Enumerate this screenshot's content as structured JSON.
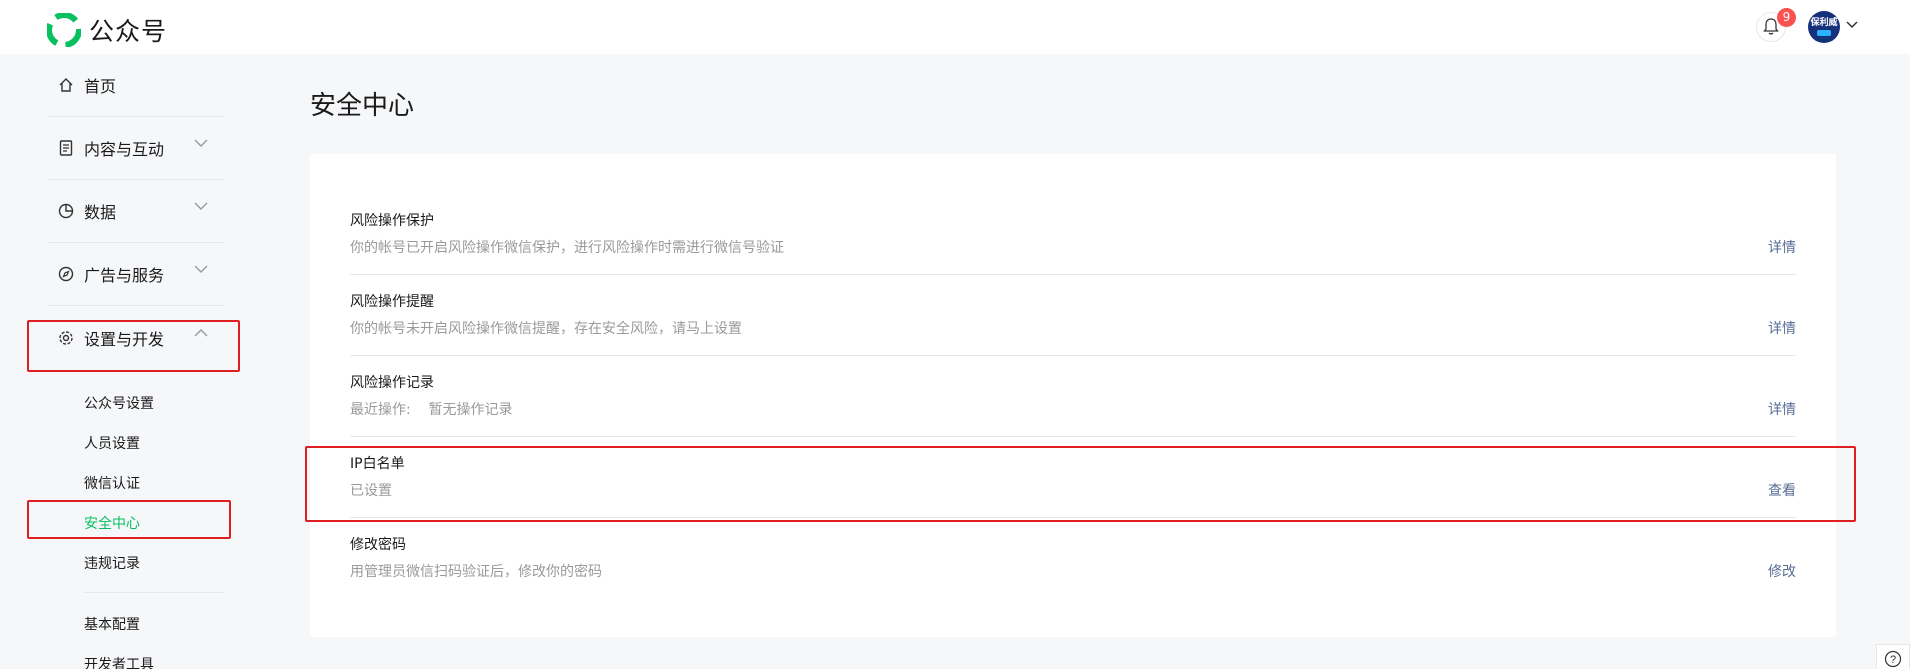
{
  "app": {
    "title": "公众号",
    "brand_color": "#07c160",
    "link_color": "#576b95",
    "alert_color": "#fa5151"
  },
  "header": {
    "notification_count": "9",
    "avatar_text": "保利威",
    "icons": [
      "wechat-logo-icon",
      "bell-icon",
      "chevron-down-icon"
    ]
  },
  "sidebar": {
    "items": [
      {
        "label": "首页",
        "icon": "home-icon"
      },
      {
        "label": "内容与互动",
        "icon": "document-icon"
      },
      {
        "label": "数据",
        "icon": "pie-chart-icon"
      },
      {
        "label": "广告与服务",
        "icon": "compass-icon"
      },
      {
        "label": "设置与开发",
        "icon": "gear-icon"
      }
    ],
    "sub_items": [
      "公众号设置",
      "人员设置",
      "微信认证",
      "安全中心",
      "违规记录"
    ],
    "active_sub": "安全中心",
    "sub_items_2": [
      "基本配置",
      "开发者工具"
    ]
  },
  "main": {
    "title": "安全中心",
    "rows": [
      {
        "title": "风险操作保护",
        "desc": "你的帐号已开启风险操作微信保护，进行风险操作时需进行微信号验证",
        "action": "详情"
      },
      {
        "title": "风险操作提醒",
        "desc": "你的帐号未开启风险操作微信提醒，存在安全风险，请马上设置",
        "action": "详情"
      },
      {
        "title": "风险操作记录",
        "desc": "最近操作:    暂无操作记录",
        "action": "详情"
      },
      {
        "title": "IP白名单",
        "desc": "已设置",
        "action": "查看"
      },
      {
        "title": "修改密码",
        "desc": "用管理员微信扫码验证后，修改你的密码",
        "action": "修改"
      }
    ]
  },
  "help": {
    "glyph": "?"
  }
}
